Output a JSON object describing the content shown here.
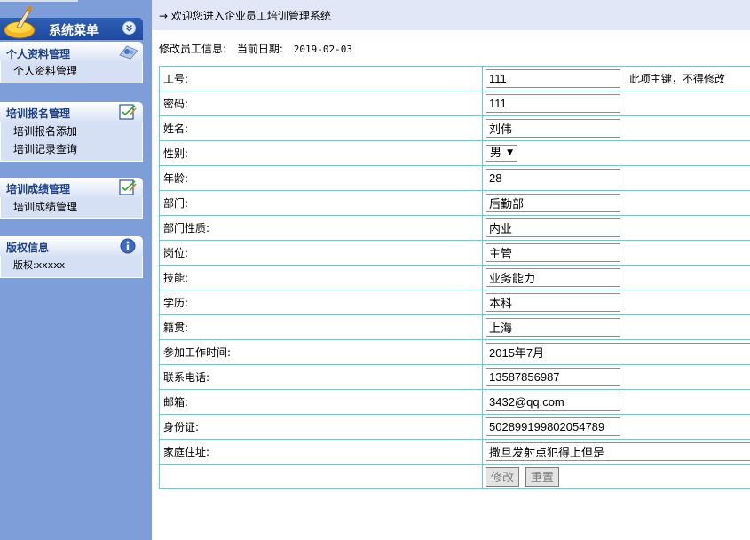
{
  "sidebar": {
    "menu_title": "系统菜单",
    "panels": [
      {
        "title": "个人资料管理",
        "items": [
          "个人资料管理"
        ]
      },
      {
        "title": "培训报名管理",
        "items": [
          "培训报名添加",
          "培训记录查询"
        ]
      },
      {
        "title": "培训成绩管理",
        "items": [
          "培训成绩管理"
        ]
      },
      {
        "title": "版权信息",
        "items": [
          "版权:xxxxx"
        ]
      }
    ]
  },
  "header": {
    "welcome": "→ 欢迎您进入企业员工培训管理系统"
  },
  "info": {
    "label": "修改员工信息:",
    "date_label": "当前日期:",
    "date_value": "2019-02-03"
  },
  "form": {
    "rows": [
      {
        "label": "工号:",
        "value": "111",
        "note": "此项主键，不得修改"
      },
      {
        "label": "密码:",
        "value": "111"
      },
      {
        "label": "姓名:",
        "value": "刘伟"
      },
      {
        "label": "性别:",
        "value": "男"
      },
      {
        "label": "年龄:",
        "value": "28"
      },
      {
        "label": "部门:",
        "value": "后勤部"
      },
      {
        "label": "部门性质:",
        "value": "内业"
      },
      {
        "label": "岗位:",
        "value": "主管"
      },
      {
        "label": "技能:",
        "value": "业务能力"
      },
      {
        "label": "学历:",
        "value": "本科"
      },
      {
        "label": "籍贯:",
        "value": "上海"
      },
      {
        "label": "参加工作时间:",
        "value": "2015年7月"
      },
      {
        "label": "联系电话:",
        "value": "13587856987"
      },
      {
        "label": "邮箱:",
        "value": "3432@qq.com"
      },
      {
        "label": "身份证:",
        "value": "502899199802054789"
      },
      {
        "label": "家庭住址:",
        "value": "撒旦发射点犯得上但是"
      }
    ],
    "submit_label": "修改",
    "reset_label": "重置"
  },
  "colors": {
    "sidebar_bg": "#7e9ed9",
    "header_bg": "#e2e7f7",
    "table_border": "#4fd7e0",
    "panel_title": "#1c3f8a"
  }
}
